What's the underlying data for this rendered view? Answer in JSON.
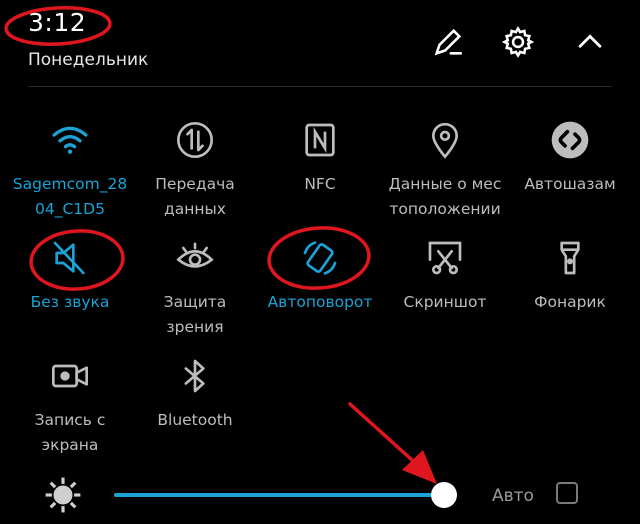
{
  "status": {
    "time": "3:12",
    "day": "Понедельник"
  },
  "header": {
    "icons": [
      "pencil-icon",
      "gear-icon",
      "chevron-up-icon"
    ]
  },
  "tiles": [
    {
      "label": "Sagemcom_28\n04_C1D5",
      "icon": "wifi-icon",
      "active": true
    },
    {
      "label": "Передача\nданных",
      "icon": "data-transfer-icon",
      "active": false
    },
    {
      "label": "NFC",
      "icon": "nfc-icon",
      "active": false
    },
    {
      "label": "Данные о мес\nтоположении",
      "icon": "location-icon",
      "active": false
    },
    {
      "label": "Автошазам",
      "icon": "shazam-icon",
      "active": false
    },
    {
      "label": "Без звука",
      "icon": "mute-icon",
      "active": true
    },
    {
      "label": "Защита\nзрения",
      "icon": "eye-icon",
      "active": false
    },
    {
      "label": "Автоповорот",
      "icon": "rotate-icon",
      "active": true
    },
    {
      "label": "Скриншот",
      "icon": "screenshot-icon",
      "active": false
    },
    {
      "label": "Фонарик",
      "icon": "flashlight-icon",
      "active": false
    },
    {
      "label": "Запись с\nэкрана",
      "icon": "screen-record-icon",
      "active": false
    },
    {
      "label": "Bluetooth",
      "icon": "bluetooth-icon",
      "active": false
    }
  ],
  "brightness": {
    "level_percent": 100,
    "auto_label": "Авто",
    "auto_checked": false
  },
  "colors": {
    "accent": "#1aa3d4",
    "annotation": "#e0161f"
  }
}
